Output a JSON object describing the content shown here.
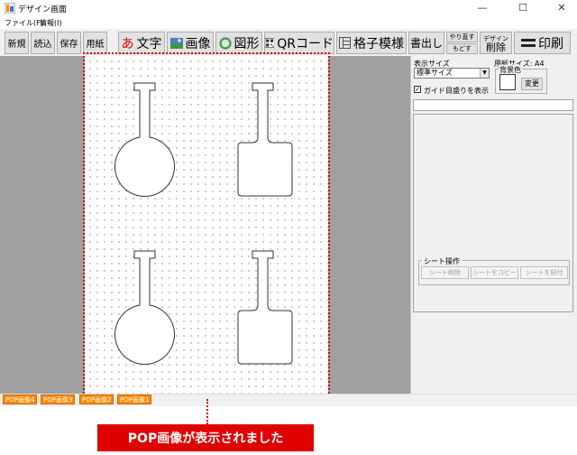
{
  "window": {
    "title": "デザイン画面",
    "controls": {
      "minimize": "—",
      "maximize": "☐",
      "close": "✕"
    }
  },
  "menu": [
    "ファイル(F)",
    "情報(I)"
  ],
  "toolbar": {
    "new": "新規",
    "open": "読込",
    "save": "保存",
    "paper": "用紙",
    "text_icon": "あ",
    "text": "文字",
    "image": "画像",
    "shape": "図形",
    "qr": "QRコード",
    "grid": "格子模様",
    "export": "書出し",
    "redo": "やり直す",
    "undo": "もどす",
    "delete_top": "デザイン",
    "delete": "削除",
    "print": "印刷"
  },
  "panel": {
    "display_size_label": "表示サイズ",
    "display_size_value": "標準サイズ",
    "paper_size_label": "用紙サイズ: A4",
    "bg_color_label": "背景色",
    "change_button": "変更",
    "guide_checkbox": "ガイド目盛りを表示",
    "guide_checked": true,
    "sheet_ops_label": "シート操作",
    "sheet_delete": "シート削除",
    "sheet_copy": "シートをコピー",
    "sheet_paste": "シートを貼付"
  },
  "tabs": [
    "POP画像4",
    "POP画像3",
    "POP画像2",
    "POP画像1"
  ],
  "callout": "POP画像が表示されました",
  "colors": {
    "accent": "#e00000",
    "tab": "#ff8a00",
    "canvas_dots": "#d08aa8"
  },
  "icons": [
    "app-icon",
    "text-icon",
    "image-icon",
    "shape-circle-icon",
    "qr-icon",
    "grid-icon",
    "print-icon"
  ]
}
